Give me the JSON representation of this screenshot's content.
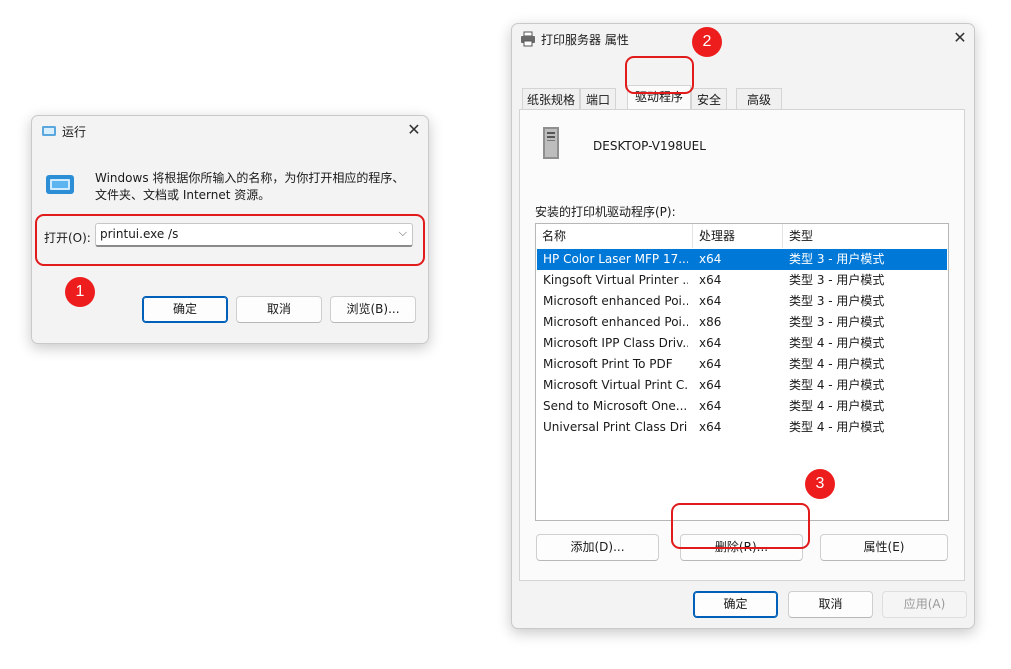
{
  "run_dialog": {
    "title": "运行",
    "description_line1": "Windows 将根据你所输入的名称，为你打开相应的程序、",
    "description_line2": "文件夹、文档或 Internet 资源。",
    "open_label": "打开(O):",
    "open_value": "printui.exe /s",
    "ok_label": "确定",
    "cancel_label": "取消",
    "browse_label": "浏览(B)..."
  },
  "props_dialog": {
    "title": "打印服务器 属性",
    "tabs": [
      "纸张规格",
      "端口",
      "驱动程序",
      "安全",
      "高级"
    ],
    "server_name": "DESKTOP-V198UEL",
    "installed_label": "安装的打印机驱动程序(P):",
    "columns": [
      "名称",
      "处理器",
      "类型"
    ],
    "drivers": [
      {
        "name": "HP Color Laser MFP 17...",
        "processor": "x64",
        "type": "类型 3 - 用户模式"
      },
      {
        "name": "Kingsoft Virtual Printer ...",
        "processor": "x64",
        "type": "类型 3 - 用户模式"
      },
      {
        "name": "Microsoft enhanced Poi...",
        "processor": "x64",
        "type": "类型 3 - 用户模式"
      },
      {
        "name": "Microsoft enhanced Poi...",
        "processor": "x86",
        "type": "类型 3 - 用户模式"
      },
      {
        "name": "Microsoft IPP Class Driv...",
        "processor": "x64",
        "type": "类型 4 - 用户模式"
      },
      {
        "name": "Microsoft Print To PDF",
        "processor": "x64",
        "type": "类型 4 - 用户模式"
      },
      {
        "name": "Microsoft Virtual Print C...",
        "processor": "x64",
        "type": "类型 4 - 用户模式"
      },
      {
        "name": "Send to Microsoft One...",
        "processor": "x64",
        "type": "类型 4 - 用户模式"
      },
      {
        "name": "Universal Print Class Dri...",
        "processor": "x64",
        "type": "类型 4 - 用户模式"
      }
    ],
    "add_label": "添加(D)...",
    "remove_label": "删除(R)...",
    "properties_label": "属性(E)",
    "ok_label": "确定",
    "cancel_label": "取消",
    "apply_label": "应用(A)"
  },
  "callouts": [
    "1",
    "2",
    "3"
  ],
  "colors": {
    "highlight": "#0078d7",
    "annotation_red": "#e11b1b",
    "badge_red": "#ee1d1d"
  }
}
